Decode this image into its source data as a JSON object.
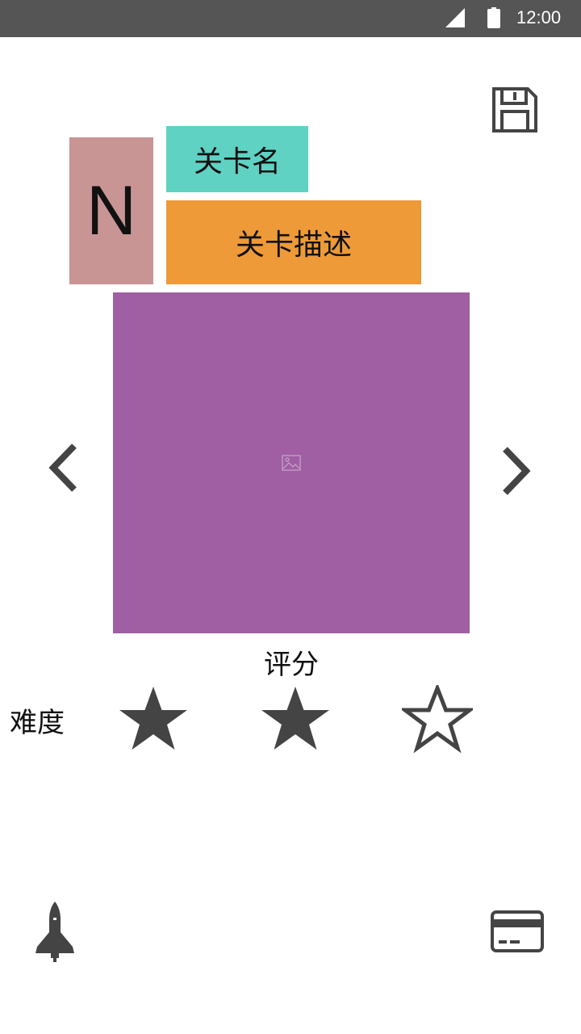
{
  "status_bar": {
    "time": "12:00",
    "signal_icon": "cell-signal-icon",
    "battery_icon": "battery-icon"
  },
  "toolbar": {
    "save_icon": "floppy-disk-icon"
  },
  "level": {
    "letter": "N",
    "name": "关卡名",
    "description": "关卡描述",
    "preview_icon": "image-placeholder-icon"
  },
  "navigation": {
    "prev_icon": "chevron-left-icon",
    "next_icon": "chevron-right-icon"
  },
  "rating": {
    "title": "评分",
    "difficulty_label": "难度",
    "stars_filled": 2,
    "stars_total": 3
  },
  "bottom_bar": {
    "left_icon": "rocket-icon",
    "right_icon": "credit-card-icon"
  },
  "colors": {
    "status_bar": "#555555",
    "letter_bg": "#c99494",
    "name_bg": "#5fd2c4",
    "description_bg": "#ee9a38",
    "preview_bg": "#a05fa2",
    "icon": "#444444"
  }
}
